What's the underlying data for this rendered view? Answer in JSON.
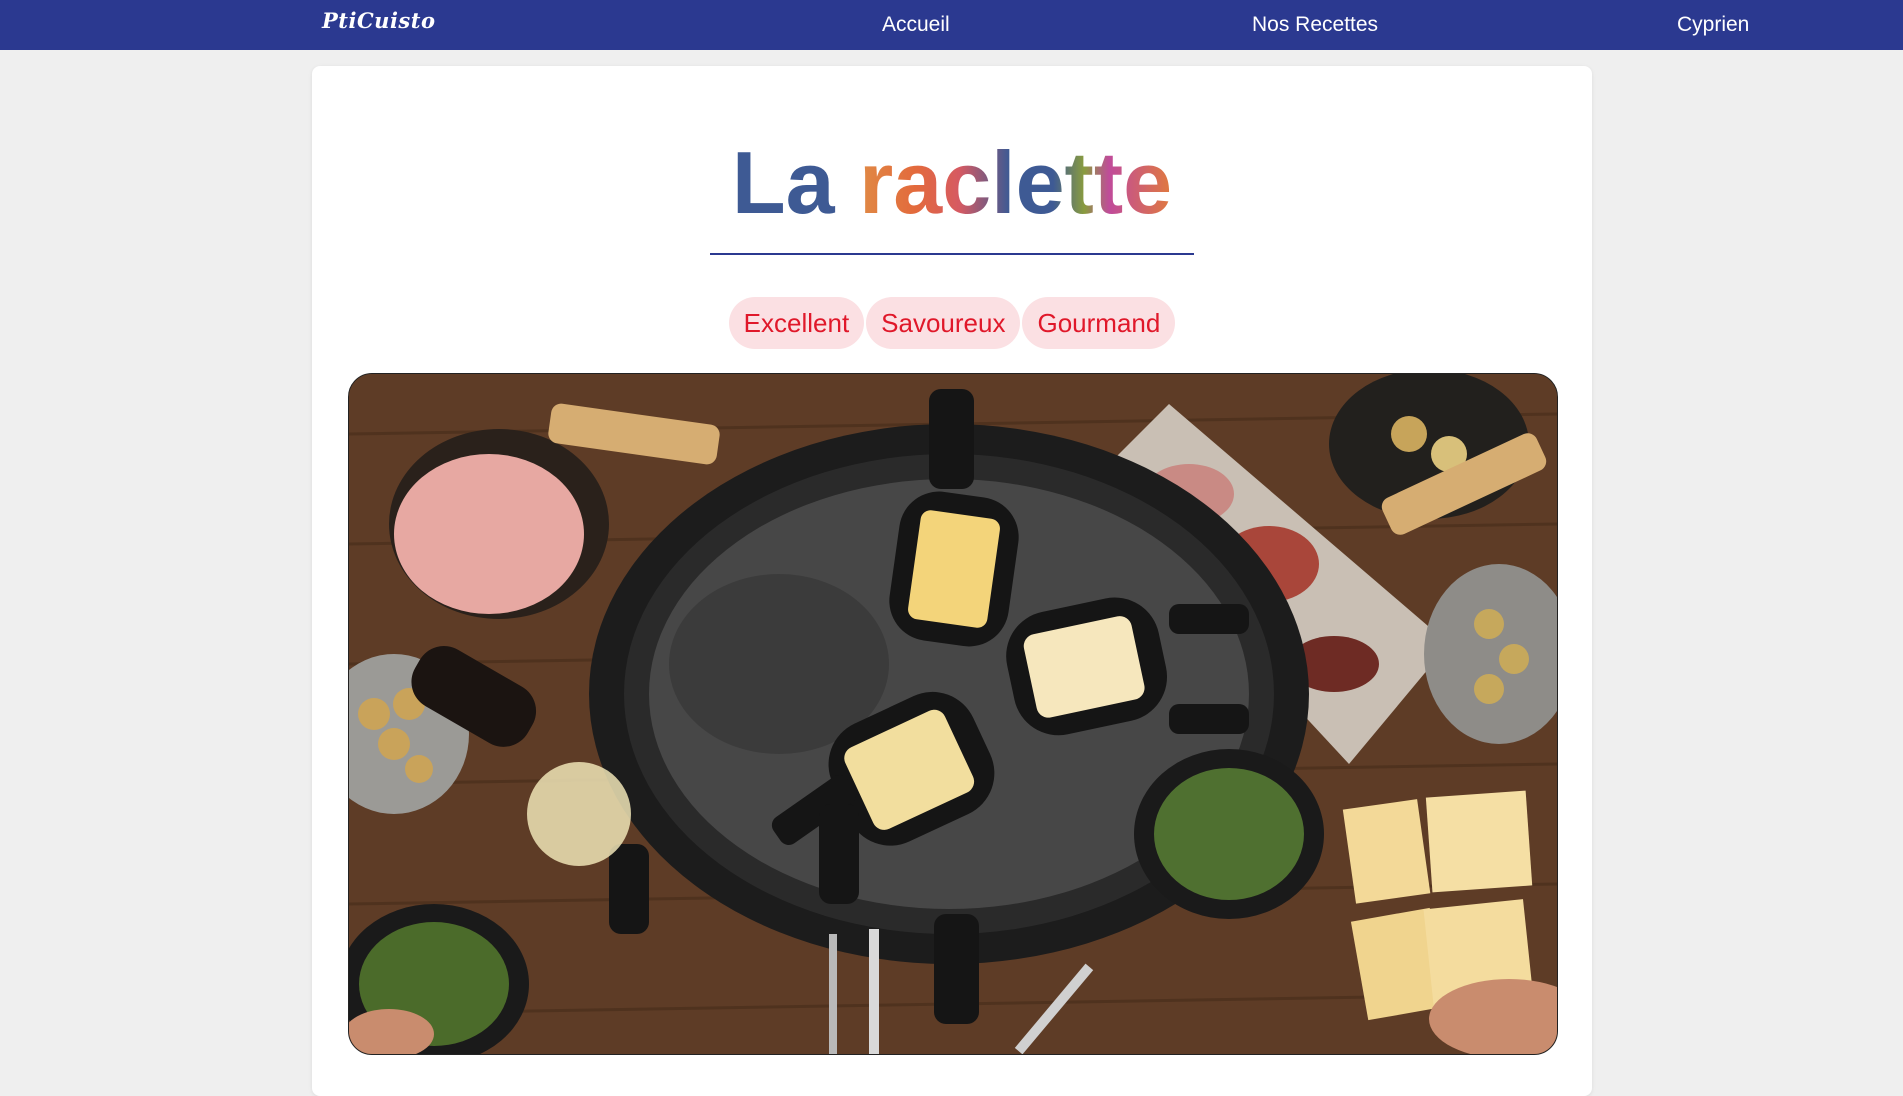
{
  "header": {
    "logo": "PtiCuisto",
    "nav": {
      "home": "Accueil",
      "recipes": "Nos Recettes",
      "user": "Cyprien"
    }
  },
  "recipe": {
    "title_part1": "La",
    "title_part2": "raclette",
    "tags": [
      "Excellent",
      "Savoureux",
      "Gourmand"
    ],
    "image_alt": "Raclette"
  },
  "colors": {
    "navbar": "#2b3990",
    "tag_background": "#fbe0e3",
    "tag_text": "#e0182a",
    "title_blue": "#3e5a94"
  }
}
